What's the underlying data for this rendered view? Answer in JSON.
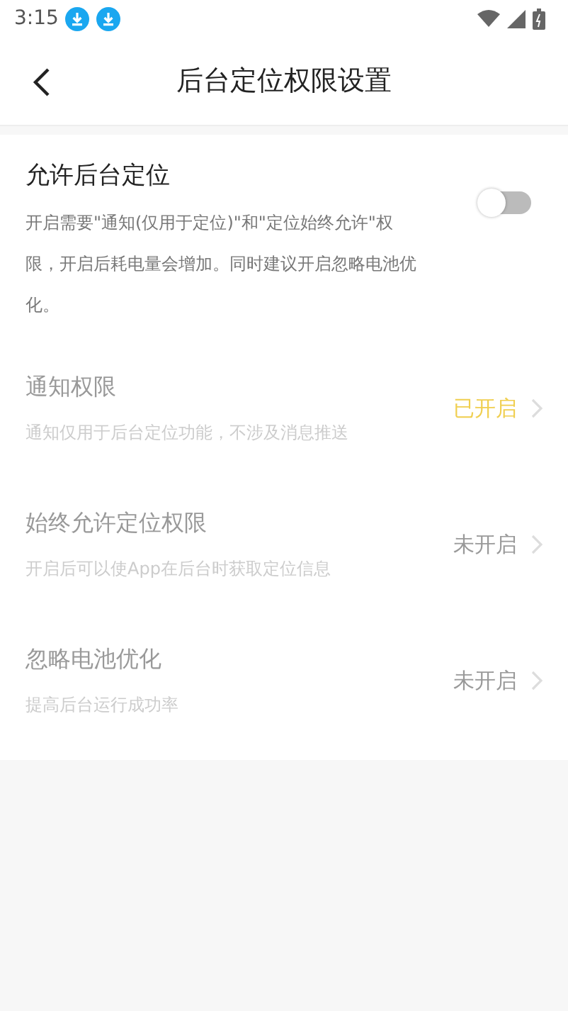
{
  "status_bar": {
    "time": "3:15"
  },
  "header": {
    "title": "后台定位权限设置"
  },
  "main_setting": {
    "title": "允许后台定位",
    "description": "开启需要\"通知(仅用于定位)\"和\"定位始终允许\"权限，开启后耗电量会增加。同时建议开启忽略电池优化。",
    "on": false
  },
  "permissions": [
    {
      "title": "通知权限",
      "description": "通知仅用于后台定位功能，不涉及消息推送",
      "status": "已开启",
      "enabled": true,
      "disabled": true
    },
    {
      "title": "始终允许定位权限",
      "description": "开启后可以使App在后台时获取定位信息",
      "status": "未开启",
      "enabled": false,
      "disabled": true
    },
    {
      "title": "忽略电池优化",
      "description": "提高后台运行成功率",
      "status": "未开启",
      "enabled": false,
      "disabled": true
    }
  ]
}
